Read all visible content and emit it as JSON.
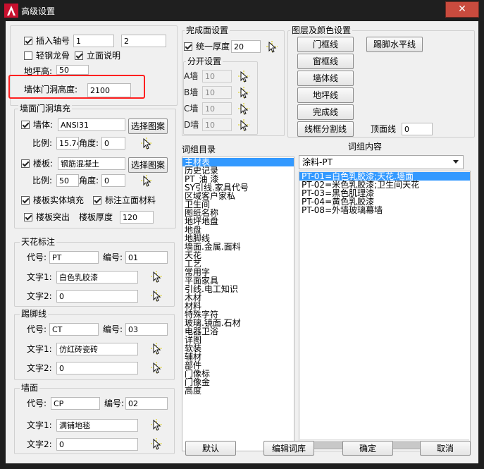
{
  "title": "高级设置",
  "close_icon": "✕",
  "axis": {
    "insert_label": "插入轴号",
    "value1": "1",
    "value2": "2",
    "light_keel_label": "轻钢龙骨",
    "elevation_note_label": "立面说明",
    "floor_height_label": "地坪高:",
    "floor_height_value": "50",
    "door_height_label": "墙体门洞高度:",
    "door_height_value": "2100"
  },
  "wall_fill": {
    "group_title": "墙面门洞填充",
    "wall_label": "墙体:",
    "wall_value": "ANSI31",
    "wall_pattern_button": "选择图案",
    "wall_scale_label": "比例:",
    "wall_scale_value": "15.74",
    "wall_angle_label": "角度:",
    "wall_angle_value": "0",
    "slab_label": "楼板:",
    "slab_value": "钢筋混凝土",
    "slab_pattern_button": "选择图案",
    "slab_scale_label": "比例:",
    "slab_scale_value": "50",
    "slab_angle_label": "角度:",
    "slab_angle_value": "0",
    "solid_fill_label": "楼板实体填充",
    "mark_material_label": "标注立面材料",
    "protrude_label": "楼板突出",
    "thickness_label": "楼板厚度",
    "thickness_value": "120"
  },
  "ceiling": {
    "group_title": "天花标注",
    "code_label": "代号:",
    "code_value": "PT",
    "num_label": "编号:",
    "num_value": "01",
    "text1_label": "文字1:",
    "text1_value": "白色乳胶漆",
    "text2_label": "文字2:",
    "text2_value": "0"
  },
  "skirting": {
    "group_title": "踢脚线",
    "code_label": "代号:",
    "code_value": "CT",
    "num_label": "编号:",
    "num_value": "03",
    "text1_label": "文字1:",
    "text1_value": "仿红砖瓷砖",
    "text2_label": "文字2:",
    "text2_value": "0"
  },
  "wall": {
    "group_title": "墙面",
    "code_label": "代号:",
    "code_value": "CP",
    "num_label": "编号:",
    "num_value": "02",
    "text1_label": "文字1:",
    "text1_value": "满铺地毯",
    "text2_label": "文字2:",
    "text2_value": "0"
  },
  "finish": {
    "group_title": "完成面设置",
    "uniform_label": "统一厚度",
    "uniform_value": "20",
    "split_title": "分开设置",
    "rows": [
      {
        "label": "A墙",
        "value": "10"
      },
      {
        "label": "B墙",
        "value": "10"
      },
      {
        "label": "C墙",
        "value": "10"
      },
      {
        "label": "D墙",
        "value": "10"
      }
    ]
  },
  "layers": {
    "group_title": "图层及颜色设置",
    "buttons": [
      "门框线",
      "窗框线",
      "墙体线",
      "地坪线",
      "完成线",
      "线框分割线"
    ],
    "skirting_button": "踢脚水平线",
    "top_line_label": "顶面线",
    "top_line_value": "0"
  },
  "catalog": {
    "title": "词组目录",
    "items": [
      "主材表",
      "历史记录",
      "PT_油 漆",
      "SY引线.家具代号",
      "区域客户家私",
      "卫生间",
      "图纸名称",
      "地坪地盘",
      "地盘",
      "地脚线",
      "墙面.金属.面料",
      "天花",
      "工艺",
      "常用字",
      "平面家具",
      "引线.电工知识",
      "木材",
      "材料",
      "特殊字符",
      "玻璃.镜面.石材",
      "电器卫浴",
      "详图",
      "软装",
      "辅材",
      "部件",
      "门像标",
      "门像金",
      "高度"
    ],
    "selected_index": 0
  },
  "content": {
    "title": "词组内容",
    "dropdown_value": "涂料-PT",
    "items": [
      "PT-01=白色乳胶漆;天花.墙面",
      "PT-02=米色乳胶漆;卫生间天花",
      "PT-03=黑色肌理漆",
      "PT-04=黄色乳胶漆",
      "PT-08=外墙玻璃幕墙"
    ],
    "selected_index": 0
  },
  "footer": {
    "default_button": "默认",
    "edit_lib_button": "编辑词库",
    "ok_button": "确定",
    "cancel_button": "取消"
  },
  "colors": {
    "highlight_box": "#ff2020",
    "selection": "#3399ff",
    "close_button": "#c94b3e"
  }
}
